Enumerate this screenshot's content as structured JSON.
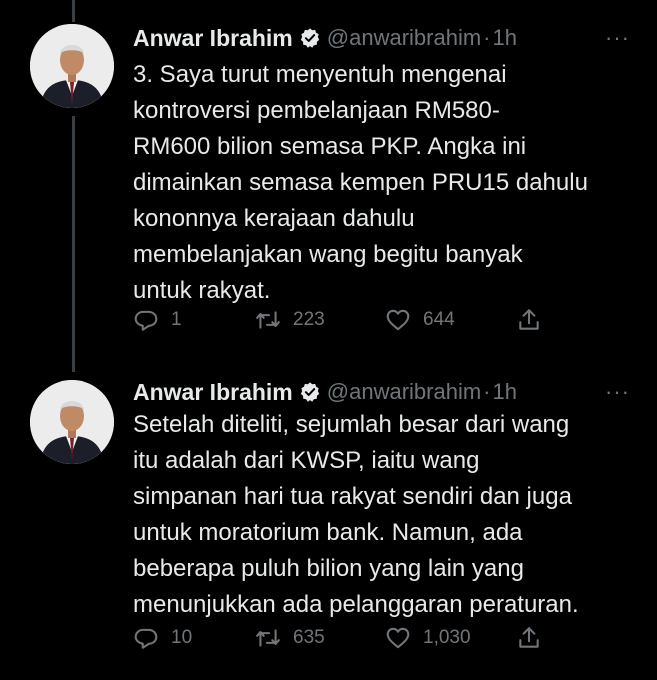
{
  "thread_line_color": "#3a3f44",
  "tweets": [
    {
      "author_name": "Anwar Ibrahim",
      "handle": "@anwaribrahim",
      "separator": "·",
      "time": "1h",
      "more": "···",
      "text": "3. Saya turut menyentuh mengenai\nkontroversi pembelanjaan RM580-\nRM600 bilion semasa PKP. Angka ini\ndimainkan semasa kempen PRU15 dahulu\nkononnya kerajaan dahulu\nmembelanjakan wang begitu banyak\nuntuk rakyat.",
      "replies": "1",
      "retweets": "223",
      "likes": "644",
      "icons": [
        "reply-icon",
        "retweet-icon",
        "like-icon",
        "share-icon"
      ]
    },
    {
      "author_name": "Anwar Ibrahim",
      "handle": "@anwaribrahim",
      "separator": "·",
      "time": "1h",
      "more": "···",
      "text": "Setelah diteliti, sejumlah besar dari wang\nitu adalah dari KWSP, iaitu wang\nsimpanan hari tua rakyat sendiri dan juga\nuntuk moratorium bank. Namun, ada\nbeberapa puluh bilion yang lain yang\nmenunjukkan ada pelanggaran peraturan.",
      "replies": "10",
      "retweets": "635",
      "likes": "1,030",
      "icons": [
        "reply-icon",
        "retweet-icon",
        "like-icon",
        "share-icon"
      ]
    }
  ]
}
